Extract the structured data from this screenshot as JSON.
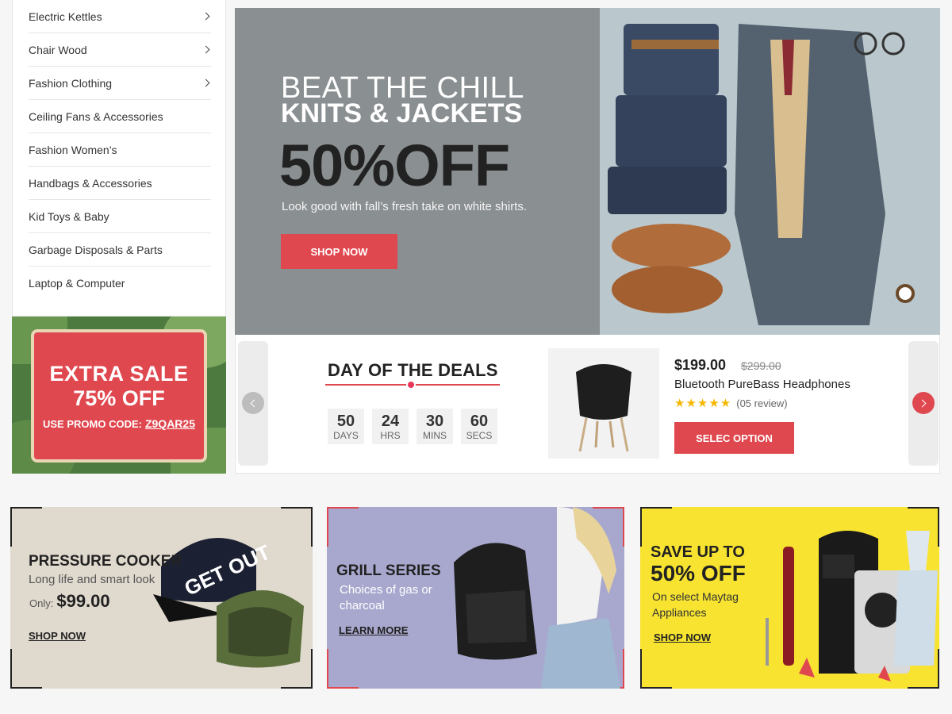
{
  "sidebar": {
    "items": [
      {
        "label": "Electric Kettles",
        "has_sub": true
      },
      {
        "label": "Chair Wood",
        "has_sub": true
      },
      {
        "label": "Fashion Clothing",
        "has_sub": true
      },
      {
        "label": "Ceiling Fans & Accessories",
        "has_sub": false
      },
      {
        "label": "Fashion Women’s",
        "has_sub": false
      },
      {
        "label": "Handbags & Accessories",
        "has_sub": false
      },
      {
        "label": "Kid Toys & Baby",
        "has_sub": false
      },
      {
        "label": "Garbage Disposals & Parts",
        "has_sub": false
      },
      {
        "label": "Laptop & Computer",
        "has_sub": false
      }
    ]
  },
  "extra_sale": {
    "line1": "EXTRA SALE",
    "line2": "75% OFF",
    "promo_label": "USE PROMO CODE:",
    "promo_code": "Z9QAR25"
  },
  "hero": {
    "line1": "BEAT THE CHILL",
    "line2": "KNITS & JACKETS",
    "line3": "50%OFF",
    "subtitle": "Look good with fall’s fresh take on white shirts.",
    "button": "SHOP NOW"
  },
  "deals": {
    "title": "DAY OF THE DEALS",
    "countdown": [
      {
        "value": "50",
        "unit": "DAYS"
      },
      {
        "value": "24",
        "unit": "HRS"
      },
      {
        "value": "30",
        "unit": "MINS"
      },
      {
        "value": "60",
        "unit": "SECS"
      }
    ],
    "price": "$199.00",
    "old_price": "$299.00",
    "product_name": "Bluetooth PureBass Headphones",
    "stars": "★★★★★",
    "rating": 5,
    "reviews": "(05 review)",
    "button": "SELEC OPTION"
  },
  "cards": {
    "pressure": {
      "title": "PRESSURE COOKER",
      "desc": "Long life and smart look",
      "only": "Only:",
      "price": "$99.00",
      "link": "SHOP NOW"
    },
    "grill": {
      "title": "GRILL SERIES",
      "desc1": "Choices of gas or",
      "desc2": "charcoal",
      "link": "LEARN MORE"
    },
    "save": {
      "line1": "SAVE UP TO",
      "line2": "50% OFF",
      "desc1": "On select Maytag",
      "desc2": "Appliances",
      "link": "SHOP NOW"
    }
  },
  "colors": {
    "accent": "#e0484f",
    "grill_bg": "#a8a8cf",
    "save_bg": "#f7e330",
    "pressure_bg": "#e0d9ce"
  }
}
